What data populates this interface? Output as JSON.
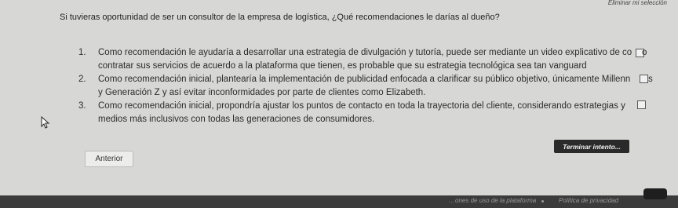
{
  "header": {
    "remove_selection": "Eliminar mi selección"
  },
  "question": "Si tuvieras oportunidad de ser un consultor de la empresa de logística, ¿Qué recomendaciones le darías al dueño?",
  "options": [
    {
      "number": "1.",
      "line1": "Como recomendación le ayudaría a desarrollar una estrategia de divulgación y tutoría, puede ser mediante un video explicativo de co",
      "line1_end": "o",
      "line2": "contratar sus servicios de acuerdo a la plataforma que tienen, es probable que su estrategia tecnológica sea tan vanguard"
    },
    {
      "number": "2.",
      "line1": "Como recomendación inicial, plantearía la implementación de publicidad enfocada a clarificar su público objetivo, únicamente Millenn",
      "line1_end": "s",
      "line2": "y Generación Z y así evitar inconformidades por parte de clientes como Elizabeth."
    },
    {
      "number": "3.",
      "line1": "Como recomendación inicial, propondría ajustar los puntos de contacto en toda la trayectoria del cliente, considerando estrategias y",
      "line1_end": "",
      "line2": "medios más inclusivos con todas las generaciones de consumidores."
    }
  ],
  "buttons": {
    "previous": "Anterior",
    "finish": "Terminar intento..."
  },
  "footer": {
    "left": "…ones de uso de la plataforma",
    "privacy": "Política de privacidad"
  }
}
